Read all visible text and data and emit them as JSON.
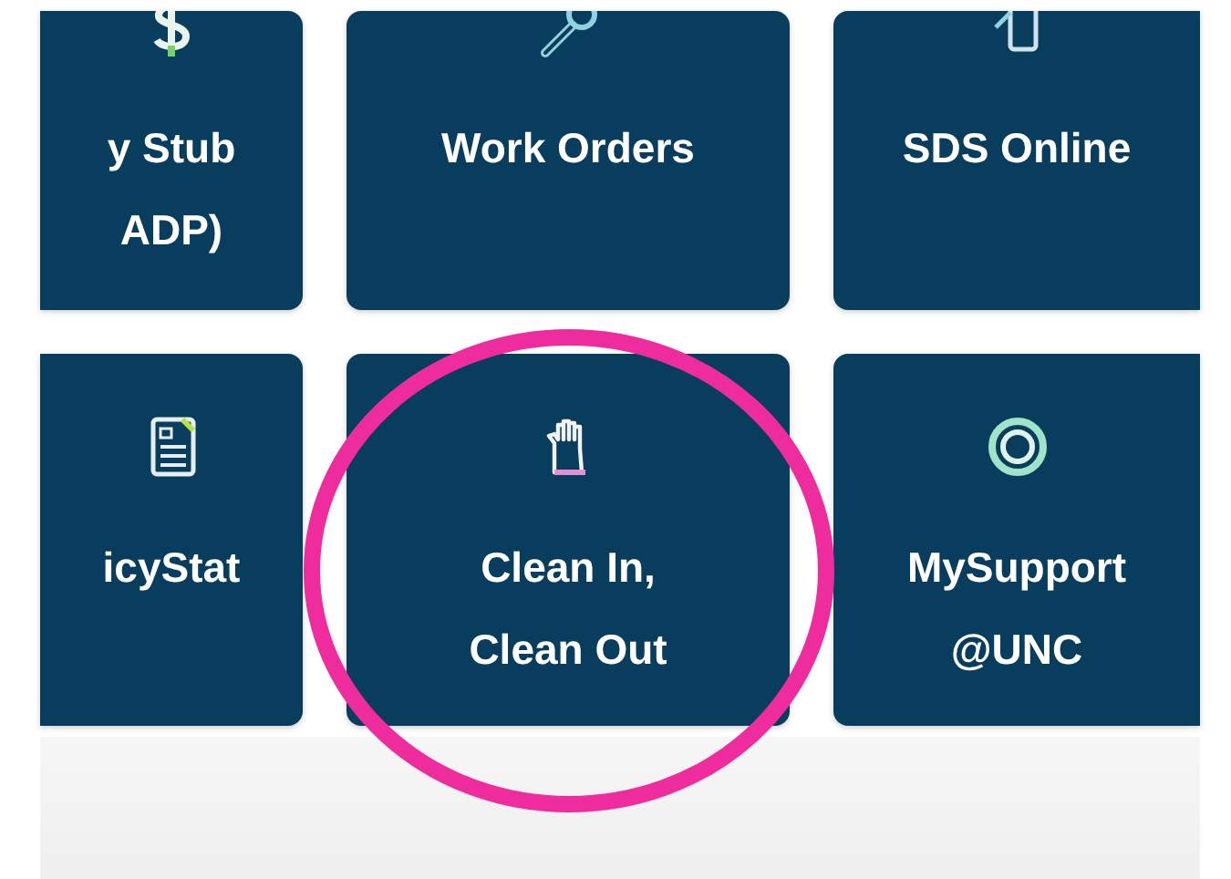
{
  "rows": [
    {
      "tiles": [
        {
          "kind": "dollar",
          "lines": [
            "y Stub",
            "ADP)"
          ]
        },
        {
          "kind": "wrench",
          "lines": [
            "Work Orders"
          ]
        },
        {
          "kind": "phone",
          "lines": [
            "SDS Online"
          ]
        }
      ]
    },
    {
      "tiles": [
        {
          "kind": "document",
          "lines": [
            "icyStat"
          ]
        },
        {
          "kind": "glove",
          "lines": [
            "Clean In,",
            "Clean Out"
          ]
        },
        {
          "kind": "ring",
          "lines": [
            "MySupport",
            "@UNC"
          ]
        }
      ]
    }
  ]
}
